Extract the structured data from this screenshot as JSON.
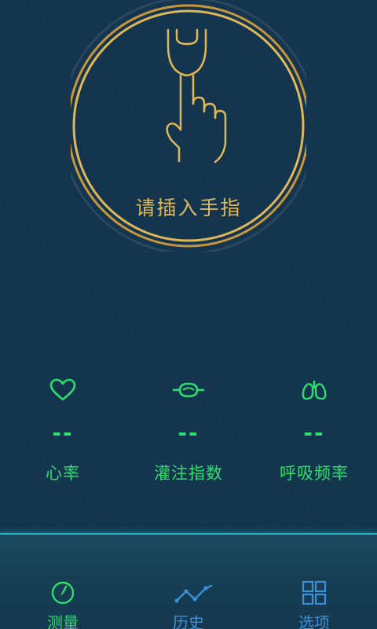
{
  "probe": {
    "prompt": "请插入手指",
    "accent_color": "#e1b75a"
  },
  "metrics": [
    {
      "icon": "heart-icon",
      "value": "--",
      "label": "心率"
    },
    {
      "icon": "perfusion-icon",
      "value": "--",
      "label": "灌注指数"
    },
    {
      "icon": "lungs-icon",
      "value": "--",
      "label": "呼吸频率"
    }
  ],
  "metric_color": "#2ddf6c",
  "tabs": [
    {
      "icon": "gauge-icon",
      "label": "测量",
      "active": true
    },
    {
      "icon": "trend-line-icon",
      "label": "历史",
      "active": false
    },
    {
      "icon": "grid-icon",
      "label": "选项",
      "active": false
    }
  ],
  "tab_active_color": "#2ddf6c",
  "tab_inactive_color": "#3b8fd6"
}
